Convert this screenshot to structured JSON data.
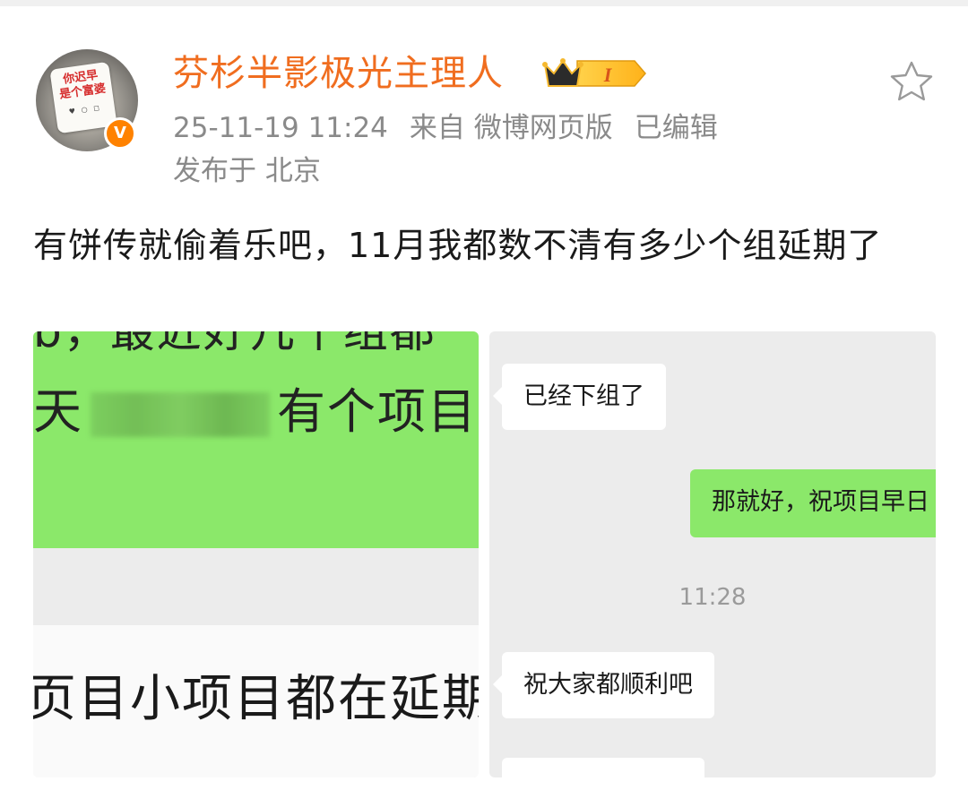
{
  "post": {
    "username": "芬杉半影极光主理人",
    "vip_level": "I",
    "avatar_text_line1": "你迟早",
    "avatar_text_line2": "是个富婆",
    "verified_badge": "V",
    "timestamp": "25-11-19 11:24",
    "source": "来自 微博网页版",
    "edited": "已编辑",
    "location": "发布于 北京",
    "text": "有饼传就偷着乐吧，11月我都数不清有多少个组延期了"
  },
  "images": {
    "left": {
      "line1": "b，最近好几个组都",
      "line2_start": "天",
      "line2_end": "有个项目也",
      "line3": "页目小项目都在延期"
    },
    "right": {
      "msg1": "已经下组了",
      "msg2": "那就好，祝项目早日",
      "time": "11:28",
      "msg3": "祝大家都顺利吧"
    }
  },
  "colors": {
    "username": "#f06d1f",
    "meta": "#8a8a8a",
    "wechat_green": "#8be86a",
    "verified": "#ff8200"
  },
  "icons": [
    "star-icon",
    "vip-crown-icon",
    "verified-icon"
  ]
}
